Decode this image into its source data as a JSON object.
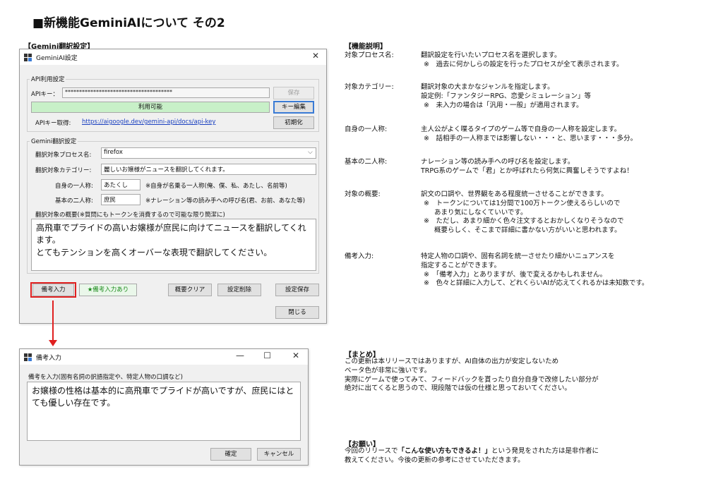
{
  "page_title": "■新機能GeminiAIについて その2",
  "settings_section_label": "【Gemini翻訳設定】",
  "main_window": {
    "title": "GeminiAI設定",
    "close": "✕",
    "api_group": {
      "label": "API利用設定",
      "api_key_label": "APIキー：",
      "api_key_value": "**************************************",
      "save_button": "保存",
      "status": "利用可能",
      "edit_key_button": "キー編集",
      "get_key_label": "APIキー取得:",
      "get_key_link": "https://aigoogle.dev/gemini-api/docs/api-key",
      "reset_button": "初期化"
    },
    "translate_group": {
      "label": "Gemini翻訳設定",
      "process_label": "翻訳対象プロセス名:",
      "process_value": "firefox",
      "category_label": "翻訳対象カテゴリー:",
      "category_value": "麗しいお嬢様がニュースを翻訳してくれます。",
      "first_person_label": "自身の一人称:",
      "first_person_value": "あたくし",
      "first_person_hint": "※自身が名乗る一人称(俺、僕、私、あたし、名前等)",
      "second_person_label": "基本の二人称:",
      "second_person_value": "庶民",
      "second_person_hint": "※ナレーション等の読み手への呼び名(君、お前、あなた等)",
      "summary_label": "翻訳対象の概要(※質問にもトークンを消費するので可能な限り簡潔に)",
      "summary_text": "高飛車でプライドの高いお嬢様が庶民に向けてニュースを翻訳してくれます。\nとてもテンションを高くオーバーな表現で翻訳してください。"
    },
    "buttons": {
      "remarks": "備考入力",
      "remarks_status": "★備考入力あり",
      "clear": "概要クリア",
      "delete": "設定削除",
      "save": "設定保存",
      "close": "閉じる"
    }
  },
  "remarks_window": {
    "title": "備考入力",
    "minimize": "—",
    "maximize": "☐",
    "close": "✕",
    "label": "備考を入力(固有名詞の訳語指定や、特定人物の口調など)",
    "text": "お嬢様の性格は基本的に高飛車でプライドが高いですが、庶民にはとても優しい存在です。",
    "ok_button": "確定",
    "cancel_button": "キャンセル"
  },
  "features": {
    "heading": "【機能説明】",
    "items": [
      {
        "key": "対象プロセス名:",
        "lines": [
          "翻訳設定を行いたいプロセス名を選択します。",
          "※　過去に何かしらの設定を行ったプロセスが全て表示されます。"
        ]
      },
      {
        "key": "対象カテゴリー:",
        "lines": [
          "翻訳対象の大まかなジャンルを指定します。",
          "設定例:「ファンタジーRPG、恋愛シミュレーション」等",
          "※　未入力の場合は「汎用・一般」が適用されます。"
        ]
      },
      {
        "key": "自身の一人称:",
        "lines": [
          "主人公がよく喋るタイプのゲーム等で自身の一人称を設定します。",
          "※　話相手の一人称までは影響しない・・・と、思います・・・多分。"
        ]
      },
      {
        "key": "基本の二人称:",
        "lines": [
          "ナレーション等の読み手への呼び名を設定します。",
          "TRPG系のゲームで「君」とか呼ばれたら何気に興奮しそうですよね！"
        ]
      },
      {
        "key": "対象の概要:",
        "lines": [
          "訳文の口調や、世界観をある程度統一させることができます。",
          "※　トークンについては1分間で100万トークン使えるらしいので",
          "　　あまり気にしなくていいです。",
          "※　ただし、あまり細かく色々注文するとおかしくなりそうなので",
          "　　概要らしく、そこまで詳細に書かない方がいいと思われます。"
        ]
      },
      {
        "key": "備考入力:",
        "lines": [
          "特定人物の口調や、固有名詞を統一させたり細かいニュアンスを",
          "指定することができます。",
          "※　「備考入力」とありますが、後で変えるかもしれません。",
          "※　色々と詳細に入力して、どれくらいAIが応えてくれるかは未知数です。"
        ]
      }
    ]
  },
  "summary": {
    "heading": "【まとめ】",
    "lines": [
      "この更新は本リリースではありますが、AI自体の出力が安定しないため",
      "ベータ色が非常に強いです。",
      "実際にゲームで使ってみて、フィードバックを貰ったり自分自身で改修したい部分が",
      "絶対に出てくると思うので、現段階では仮の仕様と思っておいてください。"
    ]
  },
  "request": {
    "heading": "【お願い】",
    "line1_prefix": "今回のリリースで",
    "line1_bold": "「こんな使い方もできるよ！」",
    "line1_suffix": "という発見をされた方は是非作者に",
    "line2": "教えてください。今後の更新の参考にさせていただきます。"
  },
  "colors": {
    "status_green": "#c8f0c8",
    "highlight_red": "#e02020",
    "link_blue": "#1a40c0",
    "remarks_status_green": "#1a8a1a"
  }
}
